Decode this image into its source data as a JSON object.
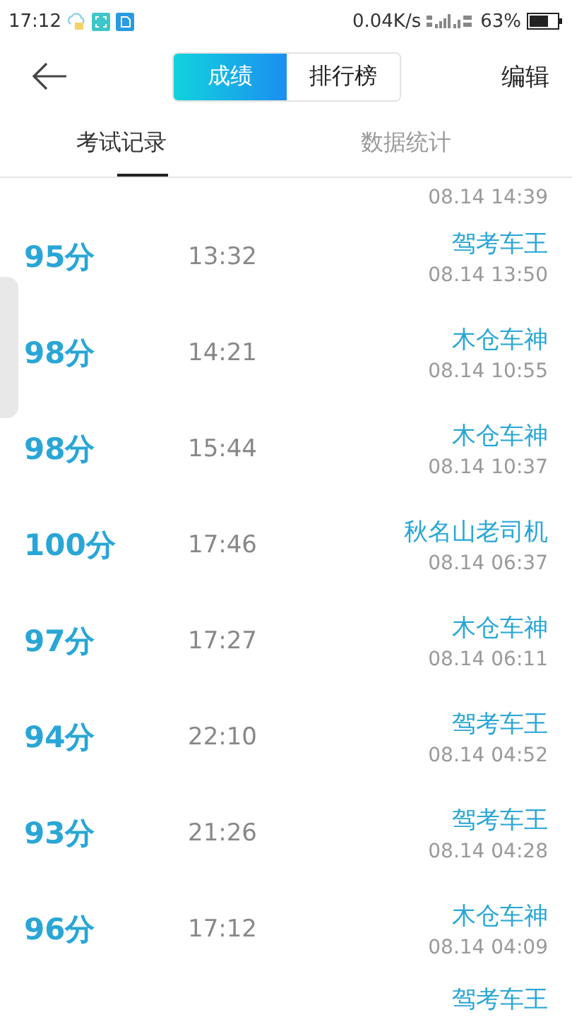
{
  "status_bar": {
    "time": "17:12",
    "speed": "0.04K/s",
    "battery": "63%"
  },
  "header": {
    "segments": [
      {
        "label": "成绩",
        "selected": true
      },
      {
        "label": "排行榜",
        "selected": false
      }
    ],
    "action": "编辑"
  },
  "tabs": [
    {
      "label": "考试记录",
      "selected": true
    },
    {
      "label": "数据统计",
      "selected": false
    }
  ],
  "top_partial_row": {
    "date": "08.14  14:39"
  },
  "records": [
    {
      "score": "95分",
      "duration": "13:32",
      "name": "驾考车王",
      "date": "08.14  13:50"
    },
    {
      "score": "98分",
      "duration": "14:21",
      "name": "木仓车神",
      "date": "08.14  10:55"
    },
    {
      "score": "98分",
      "duration": "15:44",
      "name": "木仓车神",
      "date": "08.14  10:37"
    },
    {
      "score": "100分",
      "duration": "17:46",
      "name": "秋名山老司机",
      "date": "08.14  06:37"
    },
    {
      "score": "97分",
      "duration": "17:27",
      "name": "木仓车神",
      "date": "08.14  06:11"
    },
    {
      "score": "94分",
      "duration": "22:10",
      "name": "驾考车王",
      "date": "08.14  04:52"
    },
    {
      "score": "93分",
      "duration": "21:26",
      "name": "驾考车王",
      "date": "08.14  04:28"
    },
    {
      "score": "96分",
      "duration": "17:12",
      "name": "木仓车神",
      "date": "08.14  04:09"
    }
  ],
  "bottom_partial_row": {
    "name": "驾考车王"
  }
}
